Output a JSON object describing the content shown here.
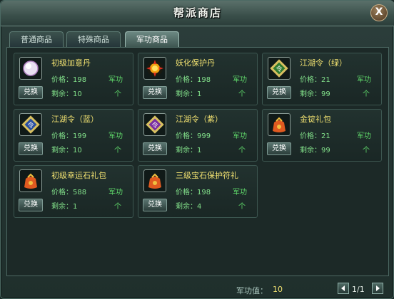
{
  "window": {
    "title": "帮派商店",
    "close_label": "X"
  },
  "tabs": [
    {
      "label": "普通商品",
      "active": false
    },
    {
      "label": "特殊商品",
      "active": false
    },
    {
      "label": "军功商品",
      "active": true
    }
  ],
  "items": [
    {
      "name": "初级加意丹",
      "price_label": "价格：198",
      "currency": "军功",
      "stock_label": "剩余：10",
      "unit": "个",
      "buy_label": "兑换",
      "icon": "pearl-icon"
    },
    {
      "name": "妖化保护丹",
      "price_label": "价格：198",
      "currency": "军功",
      "stock_label": "剩余：1",
      "unit": "个",
      "buy_label": "兑换",
      "icon": "flame-orb-icon"
    },
    {
      "name": "江湖令（绿）",
      "price_label": "价格：21",
      "currency": "军功",
      "stock_label": "剩余：99",
      "unit": "个",
      "buy_label": "兑换",
      "icon": "green-token-icon"
    },
    {
      "name": "江湖令（蓝）",
      "price_label": "价格：199",
      "currency": "军功",
      "stock_label": "剩余：10",
      "unit": "个",
      "buy_label": "兑换",
      "icon": "blue-token-icon"
    },
    {
      "name": "江湖令（紫）",
      "price_label": "价格：999",
      "currency": "军功",
      "stock_label": "剩余：1",
      "unit": "个",
      "buy_label": "兑换",
      "icon": "purple-token-icon"
    },
    {
      "name": "金锭礼包",
      "price_label": "价格：21",
      "currency": "军功",
      "stock_label": "剩余：99",
      "unit": "个",
      "buy_label": "兑换",
      "icon": "gift-bag-icon"
    },
    {
      "name": "初级幸运石礼包",
      "price_label": "价格：588",
      "currency": "军功",
      "stock_label": "剩余：1",
      "unit": "个",
      "buy_label": "兑换",
      "icon": "gift-bag-icon"
    },
    {
      "name": "三级宝石保护符礼",
      "price_label": "价格：198",
      "currency": "军功",
      "stock_label": "剩余：4",
      "unit": "个",
      "buy_label": "兑换",
      "icon": "gift-bag-icon"
    }
  ],
  "footer": {
    "merit_label": "军功值：",
    "merit_value": "10",
    "page_indicator": "1/1"
  }
}
